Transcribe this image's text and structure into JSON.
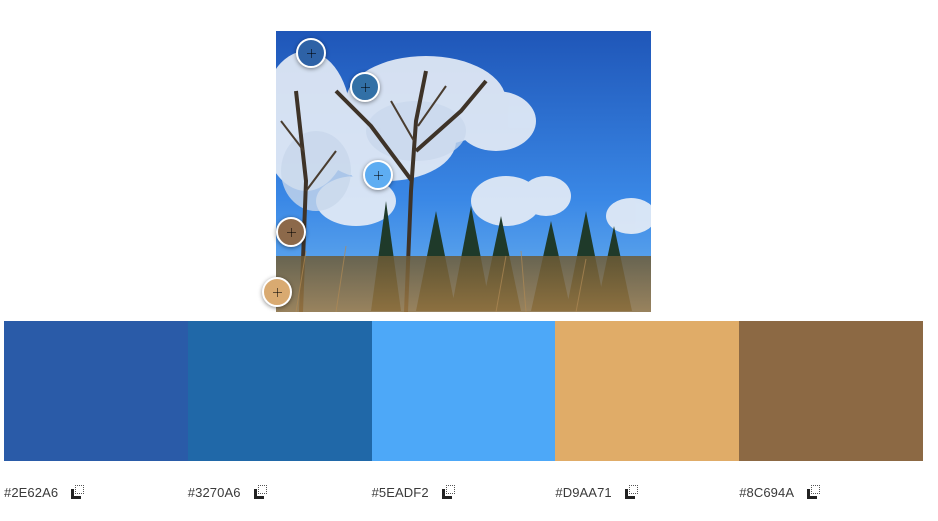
{
  "image": {
    "description_icon": "winter-tree-photo"
  },
  "pickers": [
    {
      "name": "picker-1",
      "color": "#2E62A6"
    },
    {
      "name": "picker-2",
      "color": "#3270A6"
    },
    {
      "name": "picker-3",
      "color": "#5EADF2"
    },
    {
      "name": "picker-4",
      "color": "#8C694A"
    },
    {
      "name": "picker-5",
      "color": "#D9AA71"
    }
  ],
  "palette": [
    {
      "hex": "#2E62A6",
      "color": "#2A5BA8"
    },
    {
      "hex": "#3270A6",
      "color": "#2068A8"
    },
    {
      "hex": "#5EADF2",
      "color": "#4DA8F8"
    },
    {
      "hex": "#D9AA71",
      "color": "#E0AC68"
    },
    {
      "hex": "#8C694A",
      "color": "#8C6944"
    }
  ]
}
